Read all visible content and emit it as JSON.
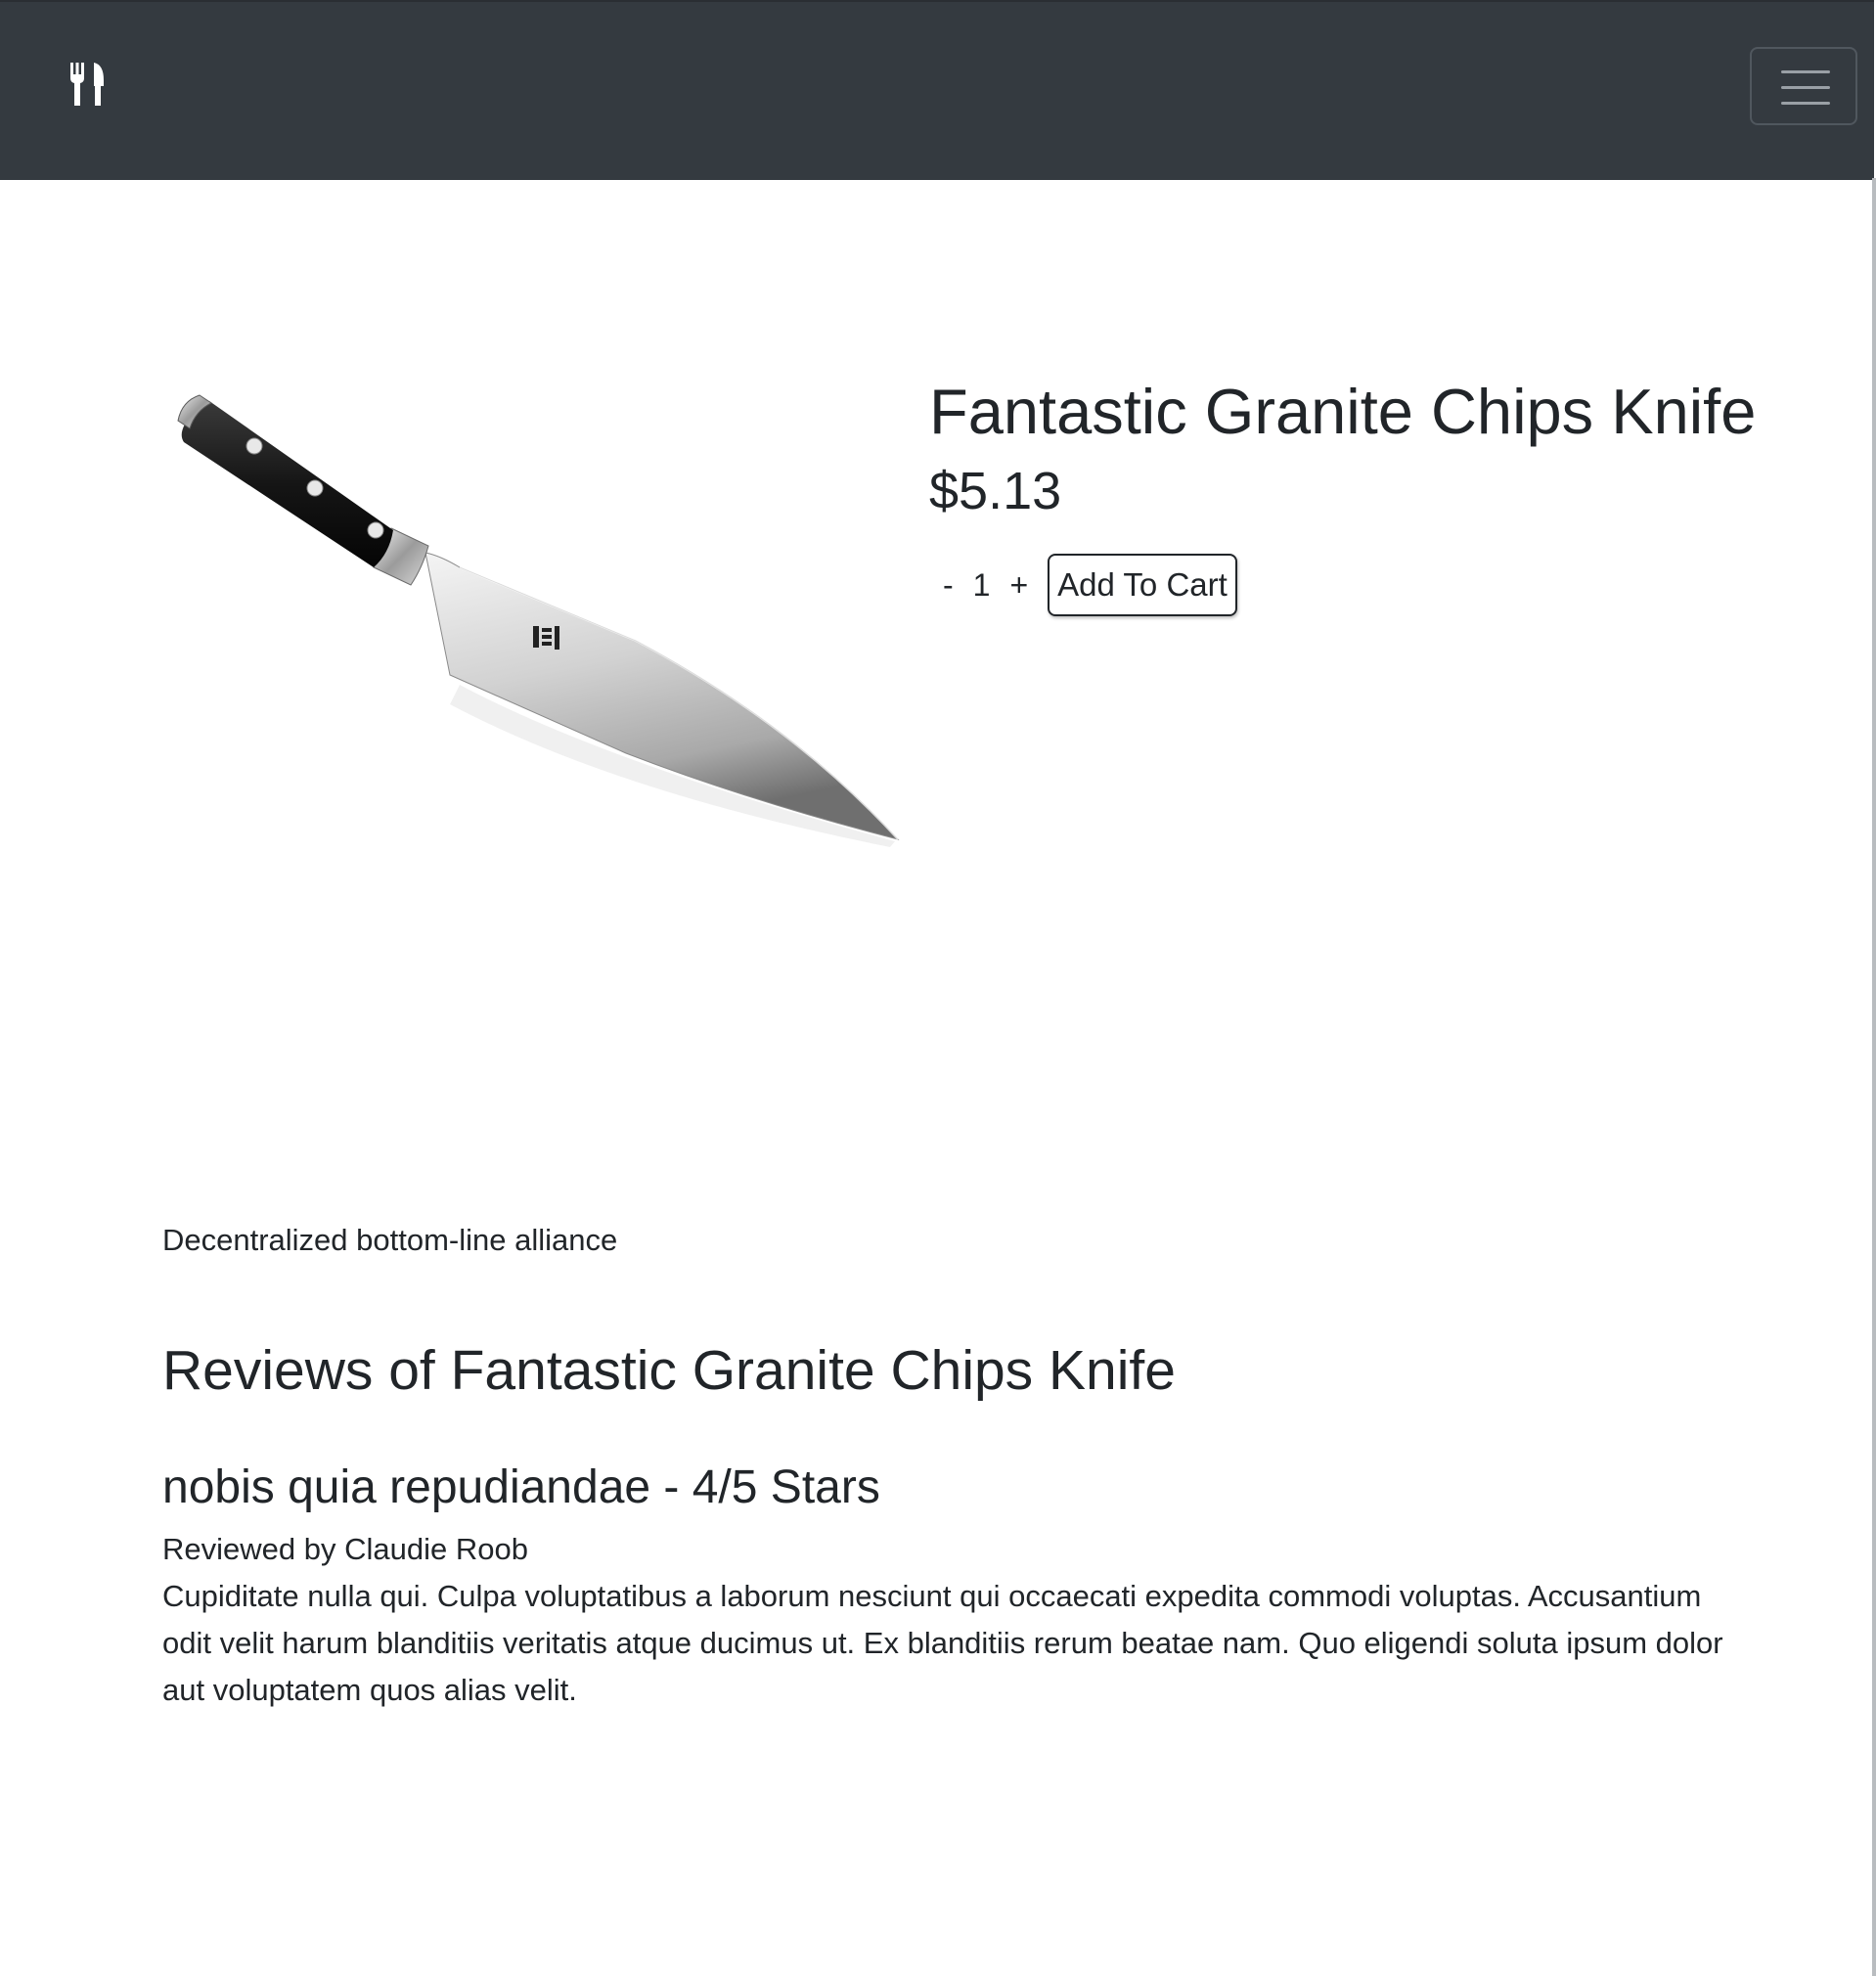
{
  "navbar": {
    "brand_icon": "utensils-icon",
    "menu_icon": "hamburger-menu-icon",
    "background": "#343a40"
  },
  "product": {
    "image_icon": "chef-knife-image",
    "title": "Fantastic Granite Chips Knife",
    "price": "$5.13",
    "quantity": {
      "minus_label": "-",
      "value": "1",
      "plus_label": "+"
    },
    "add_to_cart_label": "Add To Cart",
    "description": "Decentralized bottom-line alliance"
  },
  "reviews": {
    "heading": "Reviews of Fantastic Granite Chips Knife",
    "items": [
      {
        "title": "nobis quia repudiandae - 4/5 Stars",
        "author": "Reviewed by Claudie Roob",
        "body": "Cupiditate nulla qui. Culpa voluptatibus a laborum nesciunt qui occaecati expedita commodi voluptas. Accusantium odit velit harum blanditiis veritatis atque ducimus ut. Ex blanditiis rerum beatae nam. Quo eligendi soluta ipsum dolor aut voluptatem quos alias velit."
      }
    ]
  }
}
